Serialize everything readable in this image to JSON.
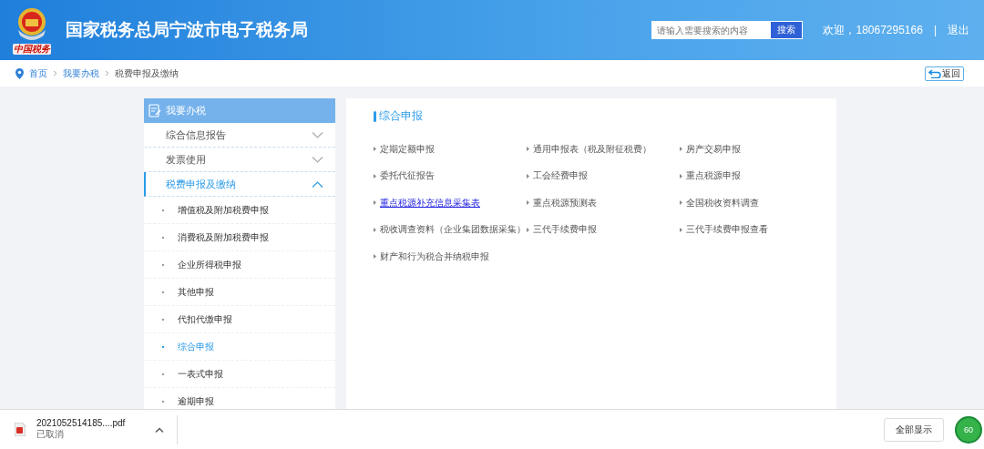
{
  "header": {
    "logo_caption": "中国税务",
    "title": "国家税务总局宁波市电子税务局",
    "search": {
      "placeholder": "请输入需要搜索的内容",
      "button": "搜索"
    },
    "welcome": "欢迎，18067295166",
    "separator": "|",
    "logout": "退出"
  },
  "breadcrumb": {
    "items": [
      "首页",
      "我要办税",
      "税费申报及缴纳"
    ],
    "back": "返回"
  },
  "sidebar": {
    "title": "我要办税",
    "sections": [
      {
        "label": "综合信息报告",
        "expanded": false
      },
      {
        "label": "发票使用",
        "expanded": false
      },
      {
        "label": "税费申报及缴纳",
        "expanded": true,
        "children": [
          {
            "label": "增值税及附加税费申报",
            "selected": false
          },
          {
            "label": "消费税及附加税费申报",
            "selected": false
          },
          {
            "label": "企业所得税申报",
            "selected": false
          },
          {
            "label": "其他申报",
            "selected": false
          },
          {
            "label": "代扣代缴申报",
            "selected": false
          },
          {
            "label": "综合申报",
            "selected": true
          },
          {
            "label": "一表式申报",
            "selected": false
          },
          {
            "label": "逾期申报",
            "selected": false
          }
        ]
      }
    ]
  },
  "content": {
    "title": "综合申报",
    "links": [
      {
        "label": "定期定额申报",
        "highlighted": false
      },
      {
        "label": "通用申报表（税及附征税费）",
        "highlighted": false
      },
      {
        "label": "房产交易申报",
        "highlighted": false
      },
      {
        "label": "委托代征报告",
        "highlighted": false
      },
      {
        "label": "工会经费申报",
        "highlighted": false
      },
      {
        "label": "重点税源申报",
        "highlighted": false
      },
      {
        "label": "重点税源补充信息采集表",
        "highlighted": true
      },
      {
        "label": "重点税源预测表",
        "highlighted": false
      },
      {
        "label": "全国税收资料调查",
        "highlighted": false
      },
      {
        "label": "税收调查资料（企业集团数据采集）",
        "highlighted": false
      },
      {
        "label": "三代手续费申报",
        "highlighted": false
      },
      {
        "label": "三代手续费申报查看",
        "highlighted": false
      },
      {
        "label": "财产和行为税合并纳税申报",
        "highlighted": false
      }
    ]
  },
  "download_bar": {
    "file": {
      "name": "2021052514185....pdf",
      "status": "已取消"
    },
    "show_all": "全部显示",
    "badge": "60"
  }
}
